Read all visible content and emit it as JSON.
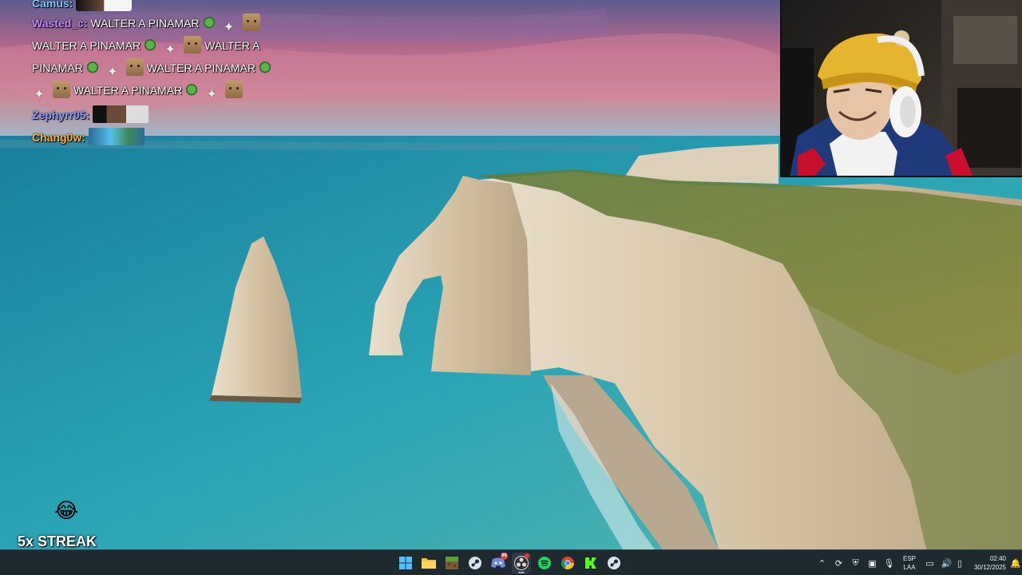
{
  "chat": {
    "lines": [
      {
        "user": "Camus:",
        "text": ""
      },
      {
        "user": "Wasted_c:",
        "text": "WALTER A PINAMAR"
      },
      {
        "text": "WALTER A PINAMAR"
      },
      {
        "text2": "WALTER A"
      },
      {
        "text": "PINAMAR"
      },
      {
        "text2": "WALTER A PINAMAR"
      },
      {
        "text": "WALTER A PINAMAR"
      },
      {
        "user": "Zephyrr05:",
        "text": ""
      },
      {
        "user": "Chang0w:",
        "text": ""
      }
    ]
  },
  "streak": {
    "label": "5x STREAK",
    "icon": "laughing-face-icon"
  },
  "taskbar": {
    "apps": [
      {
        "name": "start-button",
        "icon": "windows-logo-icon"
      },
      {
        "name": "file-explorer",
        "icon": "folder-icon"
      },
      {
        "name": "minecraft",
        "icon": "minecraft-block-icon"
      },
      {
        "name": "steam",
        "icon": "steam-icon"
      },
      {
        "name": "discord",
        "icon": "discord-icon",
        "badge": "99"
      },
      {
        "name": "obs",
        "icon": "obs-icon",
        "active": true
      },
      {
        "name": "spotify",
        "icon": "spotify-icon"
      },
      {
        "name": "chrome",
        "icon": "chrome-icon"
      },
      {
        "name": "kick",
        "icon": "kick-icon"
      },
      {
        "name": "steam-2",
        "icon": "steam-icon"
      }
    ],
    "tray": {
      "lang_top": "ESP",
      "lang_bottom": "LAA",
      "time": "02:40",
      "date": "30/12/2025"
    }
  },
  "colors": {
    "taskbar_bg": "#1f2a30",
    "chat_user_purple": "#c58cff",
    "chat_user_orange": "#ffb13b",
    "chat_user_blue": "#8a9bff"
  }
}
